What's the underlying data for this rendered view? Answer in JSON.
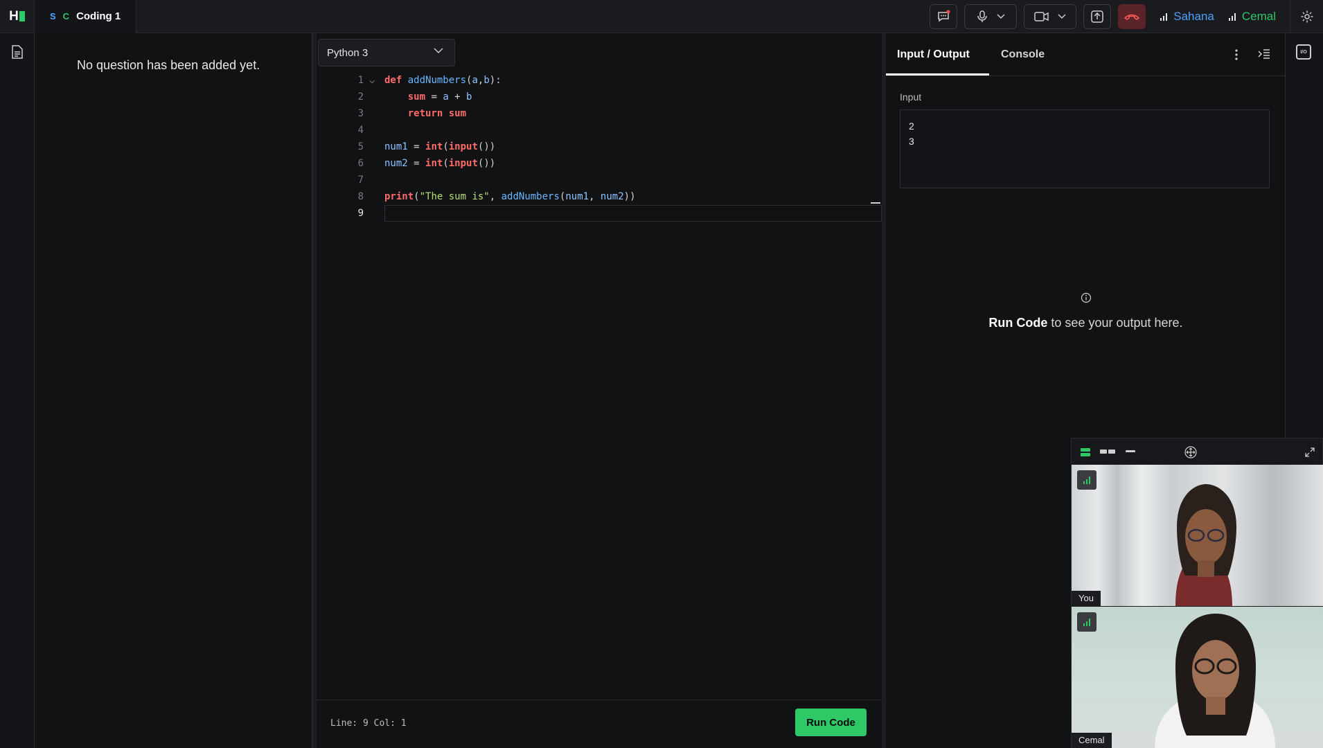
{
  "app": {
    "logo": "H"
  },
  "tab": {
    "s": "S",
    "c": "C",
    "title": "Coding 1"
  },
  "users": [
    {
      "name": "Sahana",
      "color": "#4ea1ff"
    },
    {
      "name": "Cemal",
      "color": "#2ec866"
    }
  ],
  "question": {
    "empty_message": "No question has been added yet."
  },
  "editor": {
    "language": "Python 3",
    "lines": [
      {
        "n": "1"
      },
      {
        "n": "2"
      },
      {
        "n": "3"
      },
      {
        "n": "4"
      },
      {
        "n": "5"
      },
      {
        "n": "6"
      },
      {
        "n": "7"
      },
      {
        "n": "8"
      },
      {
        "n": "9"
      }
    ],
    "code": {
      "l1": [
        "def",
        " ",
        "addNumbers",
        "(",
        "a",
        ",",
        "b",
        "):"
      ],
      "l2": [
        "sum",
        " = ",
        "a",
        " + ",
        "b"
      ],
      "l3": [
        "return",
        " ",
        "sum"
      ],
      "l5": [
        "num1",
        " = ",
        "int",
        "(",
        "input",
        "())"
      ],
      "l6": [
        "num2",
        " = ",
        "int",
        "(",
        "input",
        "())"
      ],
      "l8": [
        "print",
        "(",
        "\"The sum is\"",
        ", ",
        "addNumbers",
        "(",
        "num1",
        ", ",
        "num2",
        "))"
      ]
    },
    "status": "Line: 9 Col: 1",
    "run_label": "Run Code"
  },
  "io": {
    "tab_io": "Input / Output",
    "tab_console": "Console",
    "input_label": "Input",
    "input_value": "2\n3",
    "hint_bold": "Run Code",
    "hint_rest": " to see your output here.",
    "rail_icon": "I/O"
  },
  "video": {
    "you_label": "You",
    "cemal_label": "Cemal"
  },
  "colors": {
    "accent_green": "#2ec866",
    "accent_blue": "#4ea1ff",
    "end_call": "#5a2328"
  }
}
